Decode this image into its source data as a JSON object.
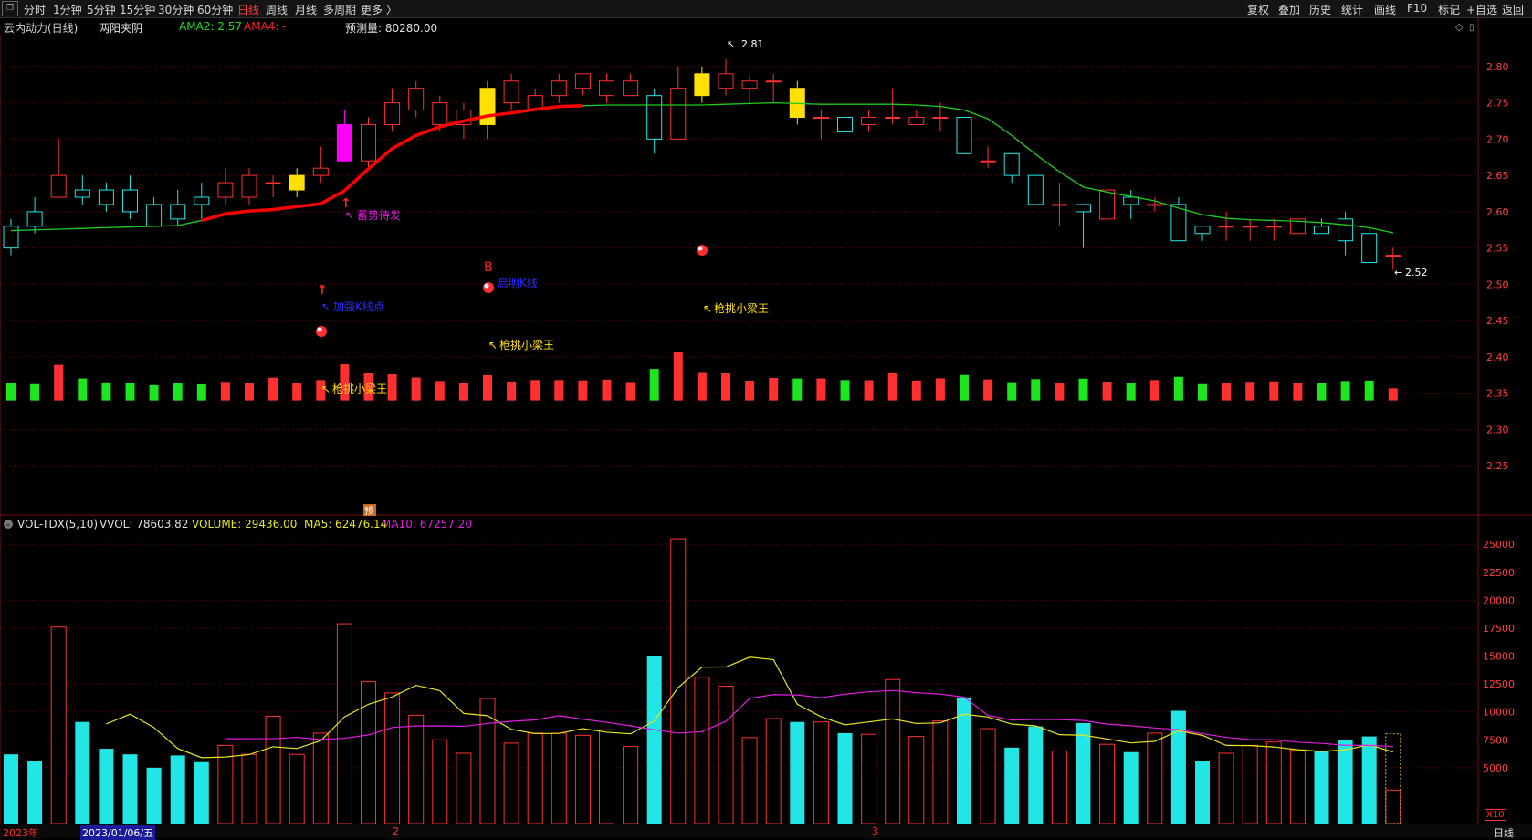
{
  "topbar": {
    "restore_icon": "restore-icon",
    "periods": [
      "分时",
      "1分钟",
      "5分钟",
      "15分钟",
      "30分钟",
      "60分钟",
      "日线",
      "周线",
      "月线",
      "多周期",
      "更多 〉"
    ],
    "active_period": "日线",
    "right_items": [
      "复权",
      "叠加",
      "历史",
      "统计",
      "画线",
      "F10",
      "标记",
      "+自选",
      "返回"
    ]
  },
  "header": {
    "stock_name": "云内动力(日线)",
    "pattern": "两阳夹阴",
    "ama2_label": "AMA2: 2.57",
    "ama4_label": "AMA4: -",
    "forecast_label": "预测量: 80280.00",
    "icons": [
      "diamond-icon",
      "window-toggle-icon"
    ]
  },
  "colors": {
    "up": "#ff3030",
    "down": "#22e6e6",
    "ama_up": "#ff0000",
    "ama_down": "#1fcc1f",
    "ma5": "#e6e61e",
    "ma10": "#e01ee0",
    "axis": "#ff4040",
    "grid": "#5a0000"
  },
  "annotations": {
    "high_label": "2.81",
    "low_label": "2.52",
    "b_marker": "B",
    "signals": [
      "蓄势待发",
      "加强K线点",
      "启明K线",
      "枪挑小梁王",
      "枪挑小梁王",
      "枪挑小梁王"
    ],
    "forecast_badge": "预"
  },
  "volume_header": {
    "indicator": "VOL-TDX(5,10)",
    "vvol": "VVOL: 78603.82",
    "volume": "VOLUME: 29436.00",
    "ma5": "MA5: 62476.14",
    "ma10": "MA10: 67257.20",
    "collapse_icon": "collapse-icon"
  },
  "bottombar": {
    "year": "2023年",
    "date": "2023/01/06/五",
    "month2": "2",
    "month3": "3",
    "right": "日线",
    "multiplier": "X10"
  },
  "chart_data": [
    {
      "type": "candlestick",
      "title": "云内动力(日线)",
      "ylim": [
        2.21,
        2.83
      ],
      "y_ticks": [
        2.25,
        2.3,
        2.35,
        2.4,
        2.45,
        2.5,
        2.55,
        2.6,
        2.65,
        2.7,
        2.75,
        2.8
      ],
      "candles": [
        [
          2.58,
          2.55,
          2.59,
          2.54
        ],
        [
          2.6,
          2.58,
          2.62,
          2.57
        ],
        [
          2.62,
          2.65,
          2.7,
          2.62
        ],
        [
          2.63,
          2.62,
          2.65,
          2.61
        ],
        [
          2.63,
          2.61,
          2.64,
          2.6
        ],
        [
          2.63,
          2.6,
          2.65,
          2.59
        ],
        [
          2.61,
          2.58,
          2.62,
          2.58
        ],
        [
          2.61,
          2.59,
          2.63,
          2.58
        ],
        [
          2.62,
          2.61,
          2.64,
          2.59
        ],
        [
          2.62,
          2.64,
          2.66,
          2.61
        ],
        [
          2.62,
          2.65,
          2.66,
          2.61
        ],
        [
          2.64,
          2.64,
          2.65,
          2.62
        ],
        [
          2.63,
          2.65,
          2.66,
          2.62
        ],
        [
          2.65,
          2.66,
          2.69,
          2.64
        ],
        [
          2.67,
          2.72,
          2.74,
          2.67
        ],
        [
          2.67,
          2.72,
          2.73,
          2.66
        ],
        [
          2.72,
          2.75,
          2.77,
          2.71
        ],
        [
          2.74,
          2.77,
          2.78,
          2.73
        ],
        [
          2.72,
          2.75,
          2.76,
          2.71
        ],
        [
          2.72,
          2.74,
          2.75,
          2.7
        ],
        [
          2.72,
          2.77,
          2.78,
          2.7
        ],
        [
          2.75,
          2.78,
          2.79,
          2.74
        ],
        [
          2.74,
          2.76,
          2.77,
          2.74
        ],
        [
          2.76,
          2.78,
          2.79,
          2.75
        ],
        [
          2.77,
          2.79,
          2.79,
          2.76
        ],
        [
          2.76,
          2.78,
          2.79,
          2.75
        ],
        [
          2.76,
          2.78,
          2.79,
          2.76
        ],
        [
          2.76,
          2.7,
          2.77,
          2.68
        ],
        [
          2.7,
          2.77,
          2.8,
          2.7
        ],
        [
          2.76,
          2.79,
          2.8,
          2.75
        ],
        [
          2.77,
          2.79,
          2.81,
          2.76
        ],
        [
          2.77,
          2.78,
          2.79,
          2.75
        ],
        [
          2.78,
          2.78,
          2.79,
          2.75
        ],
        [
          2.77,
          2.73,
          2.78,
          2.72
        ],
        [
          2.73,
          2.73,
          2.74,
          2.7
        ],
        [
          2.73,
          2.71,
          2.74,
          2.69
        ],
        [
          2.72,
          2.73,
          2.74,
          2.71
        ],
        [
          2.73,
          2.73,
          2.77,
          2.72
        ],
        [
          2.72,
          2.73,
          2.74,
          2.72
        ],
        [
          2.73,
          2.73,
          2.75,
          2.71
        ],
        [
          2.73,
          2.68,
          2.73,
          2.68
        ],
        [
          2.67,
          2.67,
          2.69,
          2.66
        ],
        [
          2.68,
          2.65,
          2.68,
          2.64
        ],
        [
          2.65,
          2.61,
          2.65,
          2.61
        ],
        [
          2.61,
          2.61,
          2.64,
          2.58
        ],
        [
          2.61,
          2.6,
          2.61,
          2.55
        ],
        [
          2.59,
          2.63,
          2.63,
          2.58
        ],
        [
          2.62,
          2.61,
          2.63,
          2.59
        ],
        [
          2.61,
          2.61,
          2.62,
          2.6
        ],
        [
          2.61,
          2.56,
          2.62,
          2.56
        ],
        [
          2.58,
          2.57,
          2.58,
          2.56
        ],
        [
          2.58,
          2.58,
          2.6,
          2.56
        ],
        [
          2.58,
          2.58,
          2.59,
          2.56
        ],
        [
          2.58,
          2.58,
          2.59,
          2.56
        ],
        [
          2.57,
          2.59,
          2.59,
          2.57
        ],
        [
          2.58,
          2.57,
          2.59,
          2.57
        ],
        [
          2.59,
          2.56,
          2.6,
          2.54
        ],
        [
          2.57,
          2.53,
          2.58,
          2.53
        ],
        [
          2.54,
          2.54,
          2.55,
          2.52
        ]
      ],
      "candle_fill": {
        "12": "#ffe000",
        "14": "#ff00ff",
        "20": "#ffe000",
        "29": "#ffe000",
        "33": "#ffe000"
      },
      "ama_line": [
        2.574,
        2.575,
        2.576,
        2.577,
        2.578,
        2.579,
        2.58,
        2.581,
        2.588,
        2.597,
        2.601,
        2.603,
        2.607,
        2.611,
        2.629,
        2.659,
        2.687,
        2.705,
        2.717,
        2.725,
        2.732,
        2.736,
        2.741,
        2.745,
        2.746,
        2.747,
        2.747,
        2.747,
        2.747,
        2.747,
        2.748,
        2.749,
        2.75,
        2.749,
        2.748,
        2.748,
        2.748,
        2.748,
        2.747,
        2.745,
        2.74,
        2.728,
        2.705,
        2.679,
        2.655,
        2.634,
        2.627,
        2.621,
        2.615,
        2.605,
        2.596,
        2.591,
        2.589,
        2.588,
        2.587,
        2.585,
        2.582,
        2.578,
        2.571
      ],
      "ama_up_range": [
        8,
        24
      ]
    },
    {
      "type": "bar",
      "title": "VOL-TDX(5,10)",
      "ylim": [
        0,
        26000
      ],
      "y_ticks": [
        5000,
        7500,
        10000,
        12500,
        15000,
        17500,
        20000,
        22500,
        25000
      ],
      "volumes": [
        6200,
        5600,
        17600,
        9100,
        6700,
        6200,
        5000,
        6100,
        5500,
        7000,
        6200,
        9600,
        6200,
        8100,
        17900,
        12700,
        11700,
        9700,
        7500,
        6300,
        11200,
        7200,
        8100,
        8100,
        7900,
        8400,
        6900,
        15000,
        25500,
        13100,
        12300,
        7700,
        9400,
        9100,
        9100,
        8100,
        8000,
        12900,
        7800,
        9200,
        11300,
        8500,
        6800,
        8700,
        6500,
        9000,
        7100,
        6400,
        8100,
        10100,
        5600,
        6300,
        7000,
        7300,
        6600,
        6500,
        7500,
        7800,
        3000
      ],
      "forecast_volume": 8028,
      "ma5": [
        null,
        null,
        null,
        null,
        8920,
        9800,
        8600,
        6720,
        5900,
        5960,
        6180,
        6880,
        6720,
        7420,
        9560,
        10680,
        11340,
        12380,
        11900,
        9860,
        9660,
        8440,
        8060,
        8080,
        8500,
        8180,
        8040,
        9180,
        12180,
        14010,
        14020,
        14900,
        14680,
        10690,
        9560,
        8840,
        9100,
        9370,
        8960,
        9020,
        9790,
        9540,
        8910,
        8750,
        7960,
        7910,
        7580,
        7220,
        7360,
        8310,
        7900,
        7000,
        6980,
        6860,
        6610,
        6460,
        6600,
        7050,
        6410
      ],
      "ma10": [
        null,
        null,
        null,
        null,
        null,
        null,
        null,
        null,
        null,
        7590,
        7600,
        7600,
        7720,
        7520,
        7640,
        7940,
        8600,
        8740,
        8750,
        8710,
        8960,
        9160,
        9280,
        9660,
        9340,
        9070,
        8750,
        8400,
        8100,
        8230,
        9150,
        11210,
        11550,
        11520,
        11270,
        11590,
        11800,
        11920,
        11720,
        11590,
        11330,
        9680,
        9270,
        9320,
        9310,
        9230,
        8900,
        8760,
        8560,
        8410,
        8050,
        7720,
        7520,
        7500,
        7290,
        7180,
        7010,
        7010,
        6900
      ]
    }
  ]
}
